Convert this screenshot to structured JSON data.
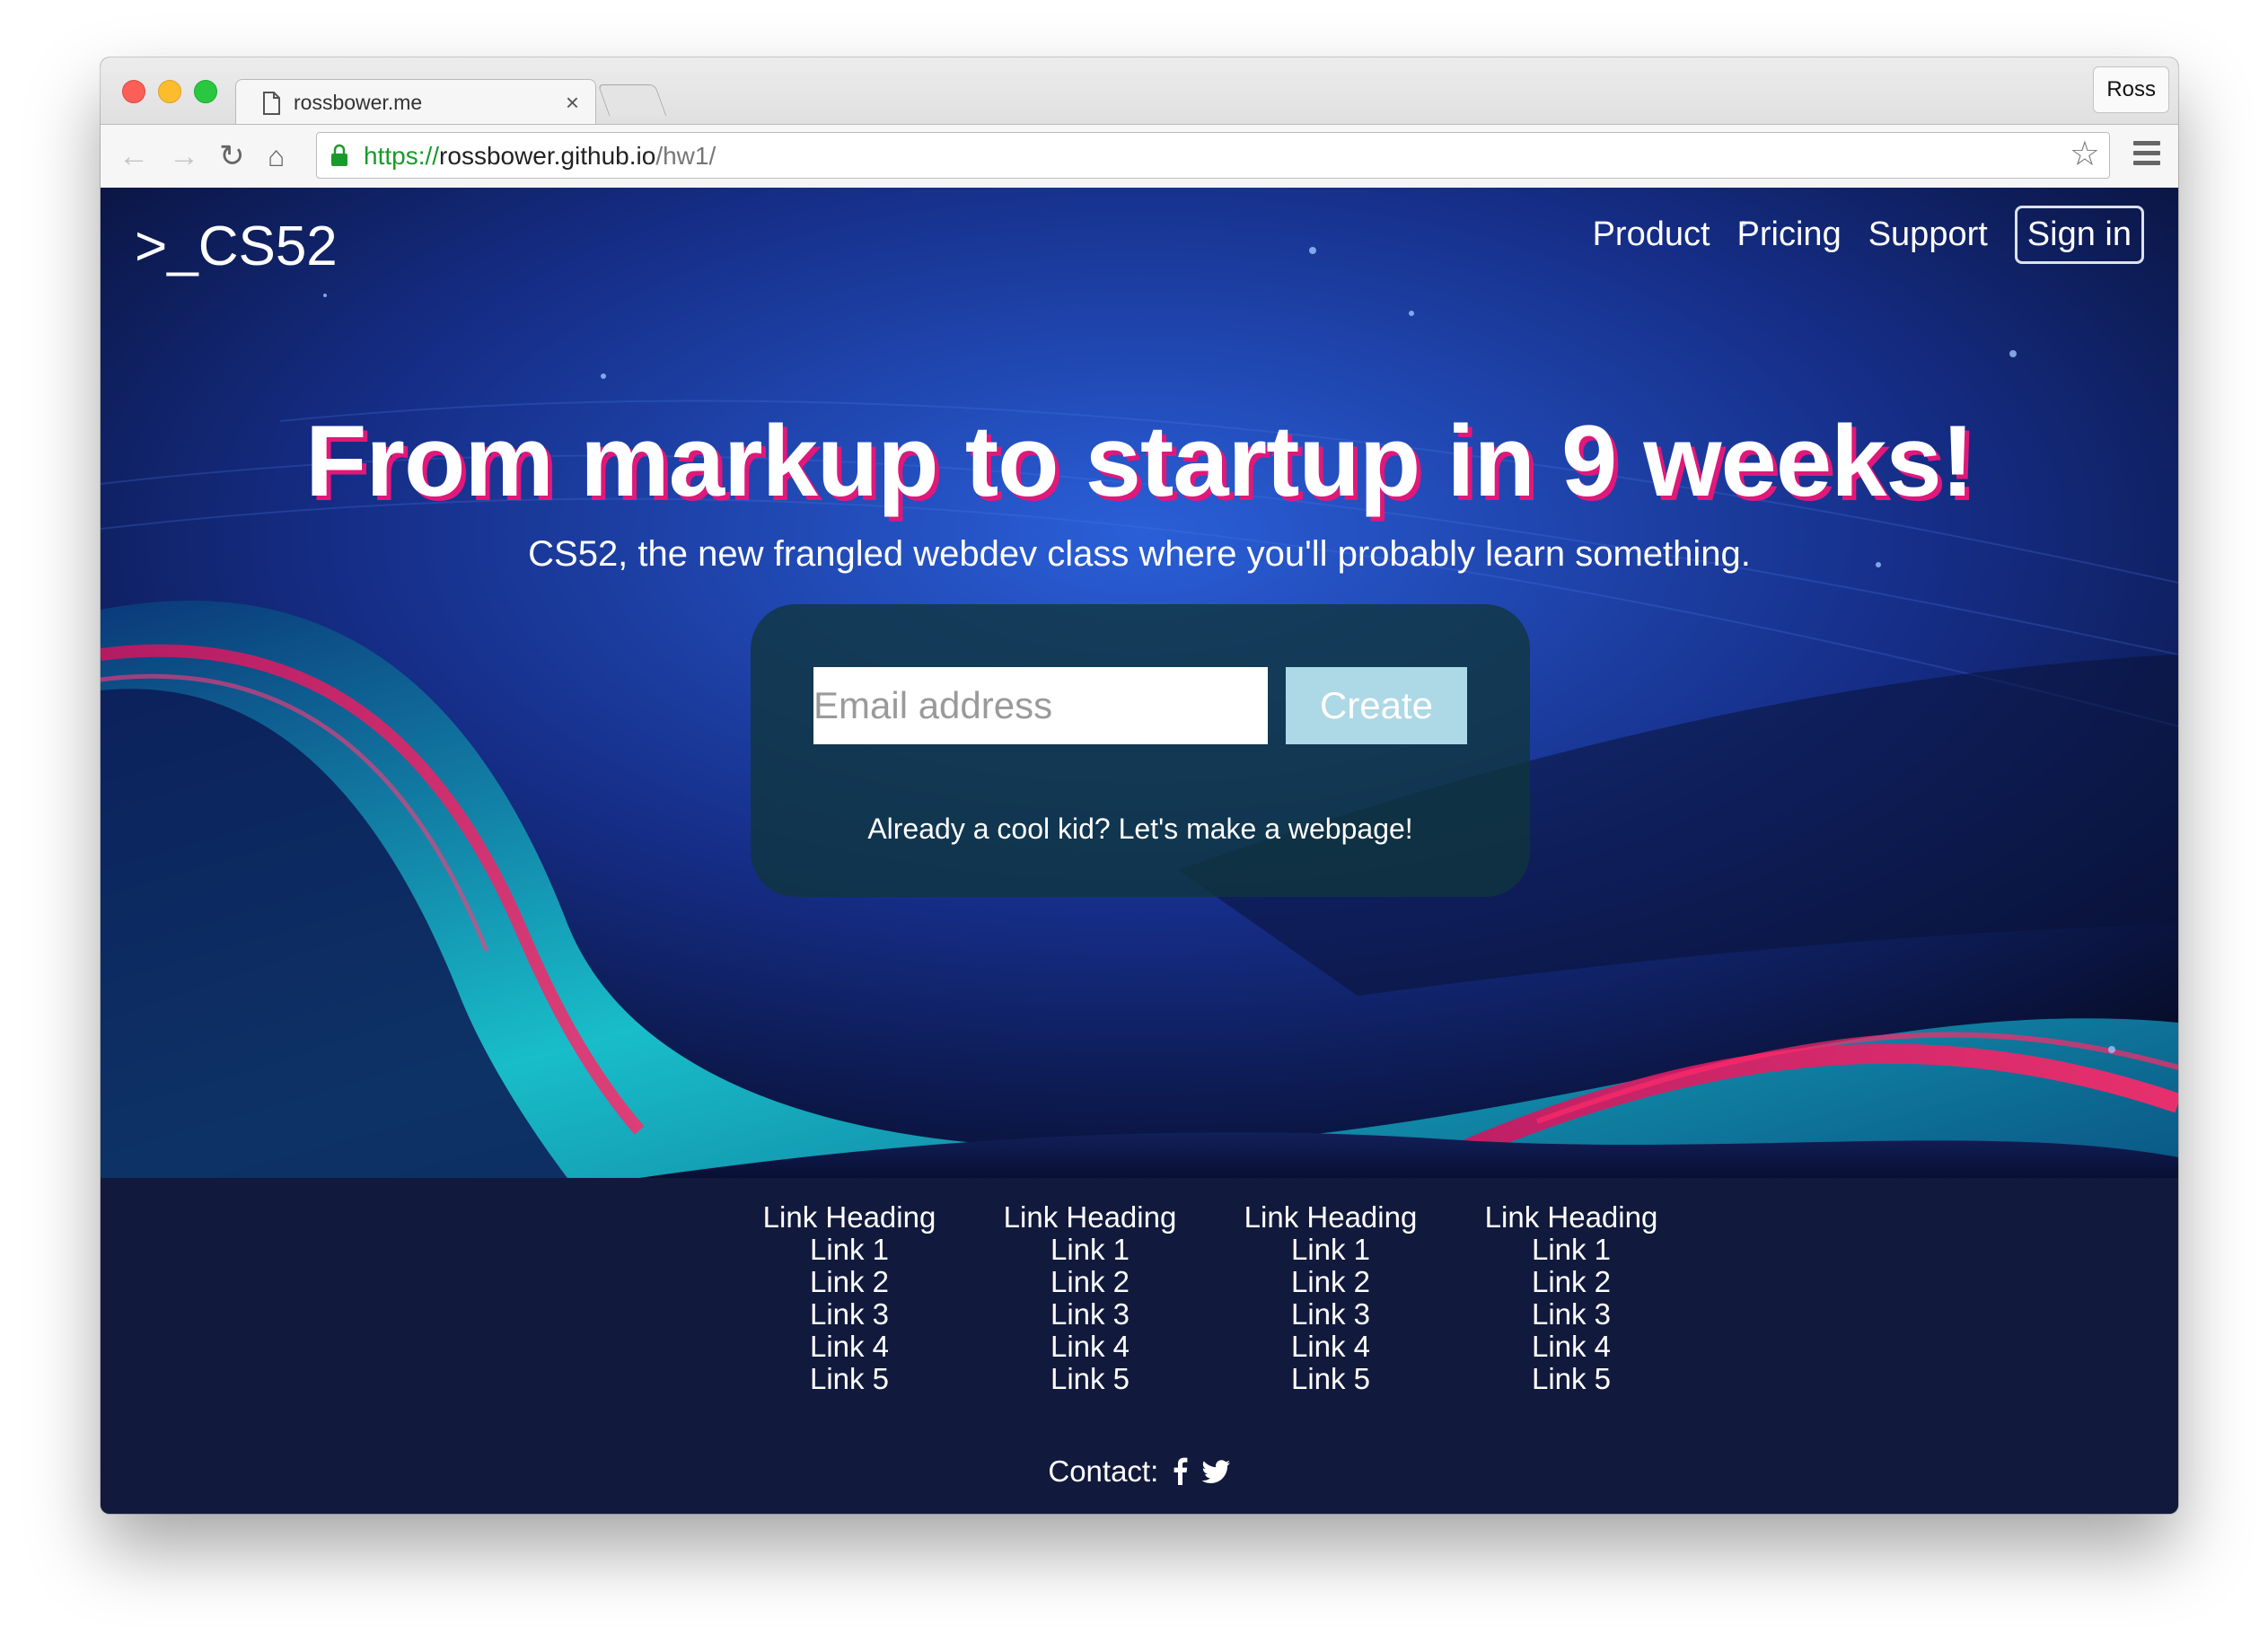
{
  "browser": {
    "tab_title": "rossbower.me",
    "tab_close": "×",
    "profile_name": "Ross",
    "url_scheme": "https://",
    "url_host": "rossbower.github.io",
    "url_path": "/hw1/",
    "icons": [
      "back-icon",
      "forward-icon",
      "reload-icon",
      "home-icon",
      "lock-icon",
      "star-icon",
      "menu-icon",
      "page-icon"
    ]
  },
  "site": {
    "brand": ">_CS52",
    "nav": [
      "Product",
      "Pricing",
      "Support",
      "Sign in"
    ],
    "headline": "From markup to startup in 9 weeks!",
    "subline": "CS52, the new frangled webdev class where you'll probably learn something.",
    "email_placeholder": "Email address",
    "create_label": "Create",
    "cool_kid": "Already a cool kid? Let's make a webpage!"
  },
  "footer": {
    "columns": [
      {
        "heading": "Link Heading",
        "links": [
          "Link 1",
          "Link 2",
          "Link 3",
          "Link 4",
          "Link 5"
        ]
      },
      {
        "heading": "Link Heading",
        "links": [
          "Link 1",
          "Link 2",
          "Link 3",
          "Link 4",
          "Link 5"
        ]
      },
      {
        "heading": "Link Heading",
        "links": [
          "Link 1",
          "Link 2",
          "Link 3",
          "Link 4",
          "Link 5"
        ]
      },
      {
        "heading": "Link Heading",
        "links": [
          "Link 1",
          "Link 2",
          "Link 3",
          "Link 4",
          "Link 5"
        ]
      }
    ],
    "contact_label": "Contact:",
    "contact_icons": [
      "facebook-icon",
      "twitter-icon"
    ]
  },
  "colors": {
    "headline_shadow": "#e0187a",
    "create_button": "#add8e6",
    "footer_bg": "#111a3c",
    "url_scheme": "#1a9a2a"
  }
}
